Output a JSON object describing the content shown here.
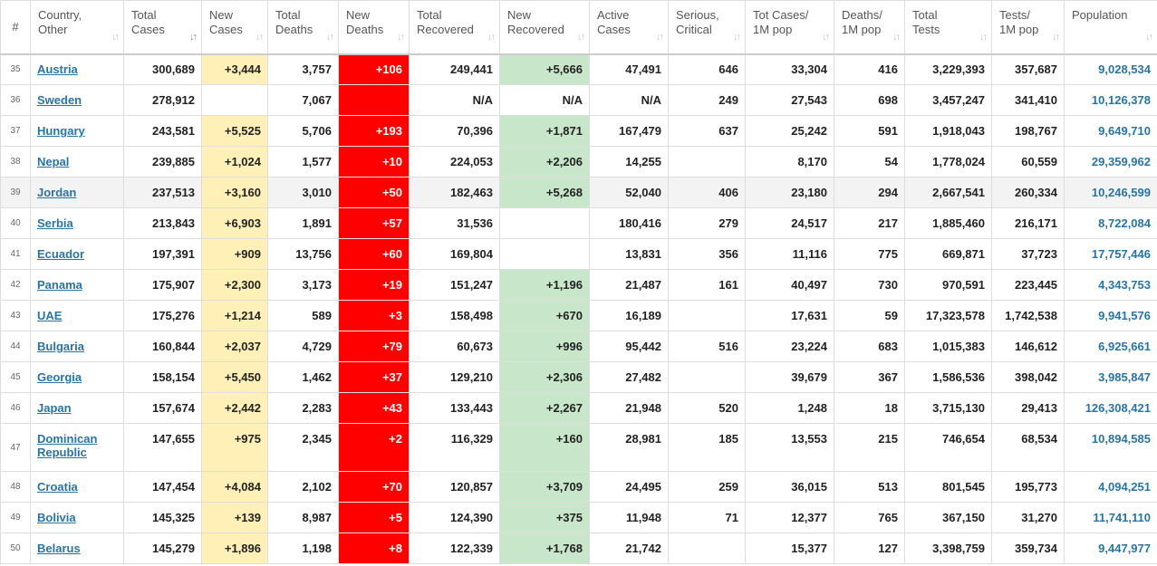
{
  "table": {
    "columns": [
      {
        "key": "num",
        "label": "#",
        "sort": false
      },
      {
        "key": "country",
        "label": "Country,\nOther",
        "sort": true
      },
      {
        "key": "total_cases",
        "label": "Total\nCases",
        "sort": true,
        "sorted": true
      },
      {
        "key": "new_cases",
        "label": "New\nCases",
        "sort": true
      },
      {
        "key": "total_deaths",
        "label": "Total\nDeaths",
        "sort": true
      },
      {
        "key": "new_deaths",
        "label": "New\nDeaths",
        "sort": true
      },
      {
        "key": "total_recovered",
        "label": "Total Recovered",
        "sort": true
      },
      {
        "key": "new_recovered",
        "label": "New\nRecovered",
        "sort": true
      },
      {
        "key": "active_cases",
        "label": "Active\nCases",
        "sort": true
      },
      {
        "key": "serious",
        "label": "Serious,\nCritical",
        "sort": true
      },
      {
        "key": "tot_cases_1m",
        "label": "Tot Cases/\n1M pop",
        "sort": true
      },
      {
        "key": "deaths_1m",
        "label": "Deaths/\n1M pop",
        "sort": true
      },
      {
        "key": "total_tests",
        "label": "Total\nTests",
        "sort": true
      },
      {
        "key": "tests_1m",
        "label": "Tests/\n1M pop",
        "sort": true
      },
      {
        "key": "population",
        "label": "Population",
        "sort": true
      }
    ],
    "rows": [
      {
        "num": "35",
        "country": "Austria",
        "total_cases": "300,689",
        "new_cases": "+3,444",
        "total_deaths": "3,757",
        "new_deaths": "+106",
        "total_recovered": "249,441",
        "new_recovered": "+5,666",
        "active_cases": "47,491",
        "serious": "646",
        "tot_cases_1m": "33,304",
        "deaths_1m": "416",
        "total_tests": "3,229,393",
        "tests_1m": "357,687",
        "population": "9,028,534"
      },
      {
        "num": "36",
        "country": "Sweden",
        "total_cases": "278,912",
        "new_cases": "",
        "total_deaths": "7,067",
        "new_deaths": "",
        "total_recovered": "N/A",
        "new_recovered": "N/A",
        "active_cases": "N/A",
        "serious": "249",
        "tot_cases_1m": "27,543",
        "deaths_1m": "698",
        "total_tests": "3,457,247",
        "tests_1m": "341,410",
        "population": "10,126,378"
      },
      {
        "num": "37",
        "country": "Hungary",
        "total_cases": "243,581",
        "new_cases": "+5,525",
        "total_deaths": "5,706",
        "new_deaths": "+193",
        "total_recovered": "70,396",
        "new_recovered": "+1,871",
        "active_cases": "167,479",
        "serious": "637",
        "tot_cases_1m": "25,242",
        "deaths_1m": "591",
        "total_tests": "1,918,043",
        "tests_1m": "198,767",
        "population": "9,649,710"
      },
      {
        "num": "38",
        "country": "Nepal",
        "total_cases": "239,885",
        "new_cases": "+1,024",
        "total_deaths": "1,577",
        "new_deaths": "+10",
        "total_recovered": "224,053",
        "new_recovered": "+2,206",
        "active_cases": "14,255",
        "serious": "",
        "tot_cases_1m": "8,170",
        "deaths_1m": "54",
        "total_tests": "1,778,024",
        "tests_1m": "60,559",
        "population": "29,359,962"
      },
      {
        "num": "39",
        "country": "Jordan",
        "total_cases": "237,513",
        "new_cases": "+3,160",
        "total_deaths": "3,010",
        "new_deaths": "+50",
        "total_recovered": "182,463",
        "new_recovered": "+5,268",
        "active_cases": "52,040",
        "serious": "406",
        "tot_cases_1m": "23,180",
        "deaths_1m": "294",
        "total_tests": "2,667,541",
        "tests_1m": "260,334",
        "population": "10,246,599"
      },
      {
        "num": "40",
        "country": "Serbia",
        "total_cases": "213,843",
        "new_cases": "+6,903",
        "total_deaths": "1,891",
        "new_deaths": "+57",
        "total_recovered": "31,536",
        "new_recovered": "",
        "active_cases": "180,416",
        "serious": "279",
        "tot_cases_1m": "24,517",
        "deaths_1m": "217",
        "total_tests": "1,885,460",
        "tests_1m": "216,171",
        "population": "8,722,084"
      },
      {
        "num": "41",
        "country": "Ecuador",
        "total_cases": "197,391",
        "new_cases": "+909",
        "total_deaths": "13,756",
        "new_deaths": "+60",
        "total_recovered": "169,804",
        "new_recovered": "",
        "active_cases": "13,831",
        "serious": "356",
        "tot_cases_1m": "11,116",
        "deaths_1m": "775",
        "total_tests": "669,871",
        "tests_1m": "37,723",
        "population": "17,757,446"
      },
      {
        "num": "42",
        "country": "Panama",
        "total_cases": "175,907",
        "new_cases": "+2,300",
        "total_deaths": "3,173",
        "new_deaths": "+19",
        "total_recovered": "151,247",
        "new_recovered": "+1,196",
        "active_cases": "21,487",
        "serious": "161",
        "tot_cases_1m": "40,497",
        "deaths_1m": "730",
        "total_tests": "970,591",
        "tests_1m": "223,445",
        "population": "4,343,753"
      },
      {
        "num": "43",
        "country": "UAE",
        "total_cases": "175,276",
        "new_cases": "+1,214",
        "total_deaths": "589",
        "new_deaths": "+3",
        "total_recovered": "158,498",
        "new_recovered": "+670",
        "active_cases": "16,189",
        "serious": "",
        "tot_cases_1m": "17,631",
        "deaths_1m": "59",
        "total_tests": "17,323,578",
        "tests_1m": "1,742,538",
        "population": "9,941,576"
      },
      {
        "num": "44",
        "country": "Bulgaria",
        "total_cases": "160,844",
        "new_cases": "+2,037",
        "total_deaths": "4,729",
        "new_deaths": "+79",
        "total_recovered": "60,673",
        "new_recovered": "+996",
        "active_cases": "95,442",
        "serious": "516",
        "tot_cases_1m": "23,224",
        "deaths_1m": "683",
        "total_tests": "1,015,383",
        "tests_1m": "146,612",
        "population": "6,925,661"
      },
      {
        "num": "45",
        "country": "Georgia",
        "total_cases": "158,154",
        "new_cases": "+5,450",
        "total_deaths": "1,462",
        "new_deaths": "+37",
        "total_recovered": "129,210",
        "new_recovered": "+2,306",
        "active_cases": "27,482",
        "serious": "",
        "tot_cases_1m": "39,679",
        "deaths_1m": "367",
        "total_tests": "1,586,536",
        "tests_1m": "398,042",
        "population": "3,985,847"
      },
      {
        "num": "46",
        "country": "Japan",
        "total_cases": "157,674",
        "new_cases": "+2,442",
        "total_deaths": "2,283",
        "new_deaths": "+43",
        "total_recovered": "133,443",
        "new_recovered": "+2,267",
        "active_cases": "21,948",
        "serious": "520",
        "tot_cases_1m": "1,248",
        "deaths_1m": "18",
        "total_tests": "3,715,130",
        "tests_1m": "29,413",
        "population": "126,308,421"
      },
      {
        "num": "47",
        "country": "Dominican Republic",
        "total_cases": "147,655",
        "new_cases": "+975",
        "total_deaths": "2,345",
        "new_deaths": "+2",
        "total_recovered": "116,329",
        "new_recovered": "+160",
        "active_cases": "28,981",
        "serious": "185",
        "tot_cases_1m": "13,553",
        "deaths_1m": "215",
        "total_tests": "746,654",
        "tests_1m": "68,534",
        "population": "10,894,585"
      },
      {
        "num": "48",
        "country": "Croatia",
        "total_cases": "147,454",
        "new_cases": "+4,084",
        "total_deaths": "2,102",
        "new_deaths": "+70",
        "total_recovered": "120,857",
        "new_recovered": "+3,709",
        "active_cases": "24,495",
        "serious": "259",
        "tot_cases_1m": "36,015",
        "deaths_1m": "513",
        "total_tests": "801,545",
        "tests_1m": "195,773",
        "population": "4,094,251"
      },
      {
        "num": "49",
        "country": "Bolivia",
        "total_cases": "145,325",
        "new_cases": "+139",
        "total_deaths": "8,987",
        "new_deaths": "+5",
        "total_recovered": "124,390",
        "new_recovered": "+375",
        "active_cases": "11,948",
        "serious": "71",
        "tot_cases_1m": "12,377",
        "deaths_1m": "765",
        "total_tests": "367,150",
        "tests_1m": "31,270",
        "population": "11,741,110"
      },
      {
        "num": "50",
        "country": "Belarus",
        "total_cases": "145,279",
        "new_cases": "+1,896",
        "total_deaths": "1,198",
        "new_deaths": "+8",
        "total_recovered": "122,339",
        "new_recovered": "+1,768",
        "active_cases": "21,742",
        "serious": "",
        "tot_cases_1m": "15,377",
        "deaths_1m": "127",
        "total_tests": "3,398,759",
        "tests_1m": "359,734",
        "population": "9,447,977"
      }
    ],
    "highlight_row": "39",
    "sort_icon": "sort-arrows-icon",
    "colors": {
      "new_cases_bg": "#fff0b8",
      "new_deaths_bg": "#ff0000",
      "new_recovered_bg": "#c8e6c9",
      "link": "#2874a6"
    }
  }
}
